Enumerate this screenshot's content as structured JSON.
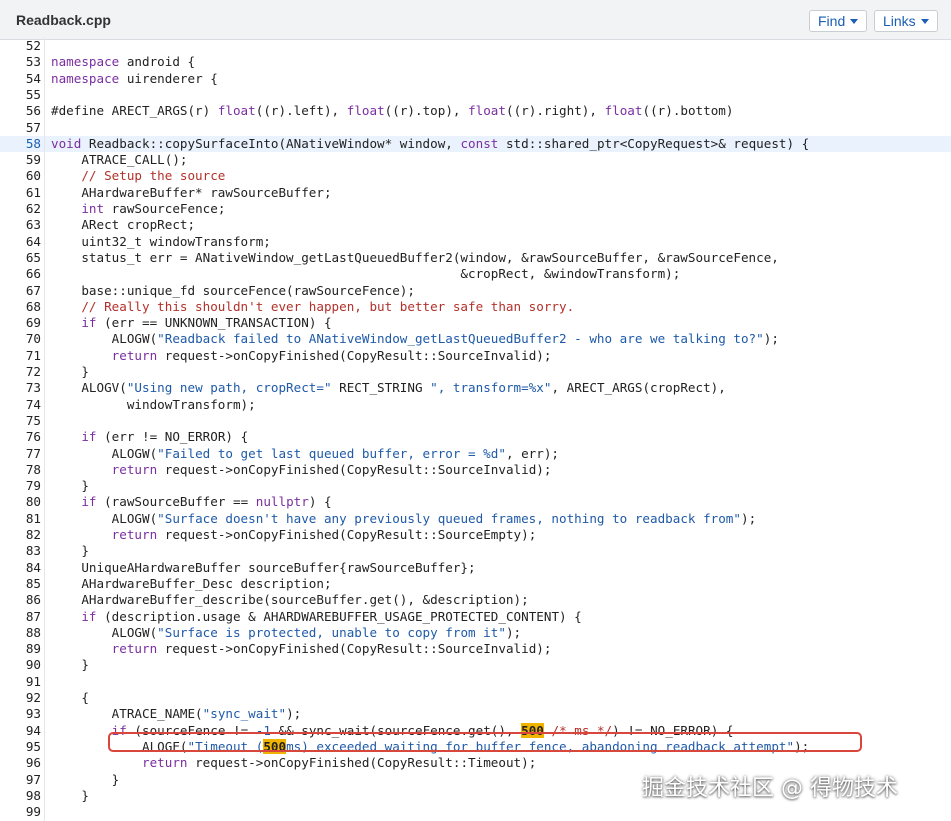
{
  "header": {
    "file_name": "Readback.cpp",
    "find_label": "Find",
    "links_label": "Links"
  },
  "code": {
    "highlighted_line": "58",
    "lines": [
      {
        "n": "52",
        "segs": []
      },
      {
        "n": "53",
        "segs": [
          {
            "t": "namespace",
            "c": "kw"
          },
          {
            "t": " android {",
            "c": ""
          }
        ]
      },
      {
        "n": "54",
        "segs": [
          {
            "t": "namespace",
            "c": "kw"
          },
          {
            "t": " uirenderer {",
            "c": ""
          }
        ]
      },
      {
        "n": "55",
        "segs": []
      },
      {
        "n": "56",
        "segs": [
          {
            "t": "#define ARECT_ARGS(r) ",
            "c": ""
          },
          {
            "t": "float",
            "c": "kw"
          },
          {
            "t": "((r).left), ",
            "c": ""
          },
          {
            "t": "float",
            "c": "kw"
          },
          {
            "t": "((r).top), ",
            "c": ""
          },
          {
            "t": "float",
            "c": "kw"
          },
          {
            "t": "((r).right), ",
            "c": ""
          },
          {
            "t": "float",
            "c": "kw"
          },
          {
            "t": "((r).bottom)",
            "c": ""
          }
        ]
      },
      {
        "n": "57",
        "segs": []
      },
      {
        "n": "58",
        "segs": [
          {
            "t": "void",
            "c": "kw"
          },
          {
            "t": " Readback::copySurfaceInto(ANativeWindow* window, ",
            "c": ""
          },
          {
            "t": "const",
            "c": "kw"
          },
          {
            "t": " std::shared_ptr<CopyRequest>& request) {",
            "c": ""
          }
        ]
      },
      {
        "n": "59",
        "segs": [
          {
            "t": "    ATRACE_CALL();",
            "c": ""
          }
        ]
      },
      {
        "n": "60",
        "segs": [
          {
            "t": "    // Setup the source",
            "c": "cm"
          }
        ]
      },
      {
        "n": "61",
        "segs": [
          {
            "t": "    AHardwareBuffer* rawSourceBuffer;",
            "c": ""
          }
        ]
      },
      {
        "n": "62",
        "segs": [
          {
            "t": "    ",
            "c": ""
          },
          {
            "t": "int",
            "c": "kw"
          },
          {
            "t": " rawSourceFence;",
            "c": ""
          }
        ]
      },
      {
        "n": "63",
        "segs": [
          {
            "t": "    ARect cropRect;",
            "c": ""
          }
        ]
      },
      {
        "n": "64",
        "segs": [
          {
            "t": "    uint32_t windowTransform;",
            "c": ""
          }
        ]
      },
      {
        "n": "65",
        "segs": [
          {
            "t": "    status_t err = ANativeWindow_getLastQueuedBuffer2(window, &rawSourceBuffer, &rawSourceFence,",
            "c": ""
          }
        ]
      },
      {
        "n": "66",
        "segs": [
          {
            "t": "                                                      &cropRect, &windowTransform);",
            "c": ""
          }
        ]
      },
      {
        "n": "67",
        "segs": [
          {
            "t": "    base::unique_fd sourceFence(rawSourceFence);",
            "c": ""
          }
        ]
      },
      {
        "n": "68",
        "segs": [
          {
            "t": "    // Really this shouldn't ever happen, but better safe than sorry.",
            "c": "cm"
          }
        ]
      },
      {
        "n": "69",
        "segs": [
          {
            "t": "    ",
            "c": ""
          },
          {
            "t": "if",
            "c": "kw"
          },
          {
            "t": " (err == UNKNOWN_TRANSACTION) {",
            "c": ""
          }
        ]
      },
      {
        "n": "70",
        "segs": [
          {
            "t": "        ALOGW(",
            "c": ""
          },
          {
            "t": "\"Readback failed to ANativeWindow_getLastQueuedBuffer2 - who are we talking to?\"",
            "c": "str"
          },
          {
            "t": ");",
            "c": ""
          }
        ]
      },
      {
        "n": "71",
        "segs": [
          {
            "t": "        ",
            "c": ""
          },
          {
            "t": "return",
            "c": "kw"
          },
          {
            "t": " request->onCopyFinished(CopyResult::SourceInvalid);",
            "c": ""
          }
        ]
      },
      {
        "n": "72",
        "segs": [
          {
            "t": "    }",
            "c": ""
          }
        ]
      },
      {
        "n": "73",
        "segs": [
          {
            "t": "    ALOGV(",
            "c": ""
          },
          {
            "t": "\"Using new path, cropRect=\"",
            "c": "str"
          },
          {
            "t": " RECT_STRING ",
            "c": ""
          },
          {
            "t": "\", transform=%x\"",
            "c": "str"
          },
          {
            "t": ", ARECT_ARGS(cropRect),",
            "c": ""
          }
        ]
      },
      {
        "n": "74",
        "segs": [
          {
            "t": "          windowTransform);",
            "c": ""
          }
        ]
      },
      {
        "n": "75",
        "segs": []
      },
      {
        "n": "76",
        "segs": [
          {
            "t": "    ",
            "c": ""
          },
          {
            "t": "if",
            "c": "kw"
          },
          {
            "t": " (err != NO_ERROR) {",
            "c": ""
          }
        ]
      },
      {
        "n": "77",
        "segs": [
          {
            "t": "        ALOGW(",
            "c": ""
          },
          {
            "t": "\"Failed to get last queued buffer, error = %d\"",
            "c": "str"
          },
          {
            "t": ", err);",
            "c": ""
          }
        ]
      },
      {
        "n": "78",
        "segs": [
          {
            "t": "        ",
            "c": ""
          },
          {
            "t": "return",
            "c": "kw"
          },
          {
            "t": " request->onCopyFinished(CopyResult::SourceInvalid);",
            "c": ""
          }
        ]
      },
      {
        "n": "79",
        "segs": [
          {
            "t": "    }",
            "c": ""
          }
        ]
      },
      {
        "n": "80",
        "segs": [
          {
            "t": "    ",
            "c": ""
          },
          {
            "t": "if",
            "c": "kw"
          },
          {
            "t": " (rawSourceBuffer == ",
            "c": ""
          },
          {
            "t": "nullptr",
            "c": "kw"
          },
          {
            "t": ") {",
            "c": ""
          }
        ]
      },
      {
        "n": "81",
        "segs": [
          {
            "t": "        ALOGW(",
            "c": ""
          },
          {
            "t": "\"Surface doesn't have any previously queued frames, nothing to readback from\"",
            "c": "str"
          },
          {
            "t": ");",
            "c": ""
          }
        ]
      },
      {
        "n": "82",
        "segs": [
          {
            "t": "        ",
            "c": ""
          },
          {
            "t": "return",
            "c": "kw"
          },
          {
            "t": " request->onCopyFinished(CopyResult::SourceEmpty);",
            "c": ""
          }
        ]
      },
      {
        "n": "83",
        "segs": [
          {
            "t": "    }",
            "c": ""
          }
        ]
      },
      {
        "n": "84",
        "segs": [
          {
            "t": "    UniqueAHardwareBuffer sourceBuffer{rawSourceBuffer};",
            "c": ""
          }
        ]
      },
      {
        "n": "85",
        "segs": [
          {
            "t": "    AHardwareBuffer_Desc description;",
            "c": ""
          }
        ]
      },
      {
        "n": "86",
        "segs": [
          {
            "t": "    AHardwareBuffer_describe(sourceBuffer.get(), &description);",
            "c": ""
          }
        ]
      },
      {
        "n": "87",
        "segs": [
          {
            "t": "    ",
            "c": ""
          },
          {
            "t": "if",
            "c": "kw"
          },
          {
            "t": " (description.usage & AHARDWAREBUFFER_USAGE_PROTECTED_CONTENT) {",
            "c": ""
          }
        ]
      },
      {
        "n": "88",
        "segs": [
          {
            "t": "        ALOGW(",
            "c": ""
          },
          {
            "t": "\"Surface is protected, unable to copy from it\"",
            "c": "str"
          },
          {
            "t": ");",
            "c": ""
          }
        ]
      },
      {
        "n": "89",
        "segs": [
          {
            "t": "        ",
            "c": ""
          },
          {
            "t": "return",
            "c": "kw"
          },
          {
            "t": " request->onCopyFinished(CopyResult::SourceInvalid);",
            "c": ""
          }
        ]
      },
      {
        "n": "90",
        "segs": [
          {
            "t": "    }",
            "c": ""
          }
        ]
      },
      {
        "n": "91",
        "segs": []
      },
      {
        "n": "92",
        "segs": [
          {
            "t": "    {",
            "c": ""
          }
        ]
      },
      {
        "n": "93",
        "segs": [
          {
            "t": "        ATRACE_NAME(",
            "c": ""
          },
          {
            "t": "\"sync_wait\"",
            "c": "str"
          },
          {
            "t": ");",
            "c": ""
          }
        ]
      },
      {
        "n": "94",
        "segs": [
          {
            "t": "        ",
            "c": ""
          },
          {
            "t": "if",
            "c": "kw"
          },
          {
            "t": " (sourceFence != ",
            "c": ""
          },
          {
            "t": "-1",
            "c": "str"
          },
          {
            "t": " && sync_wait(sourceFence.get(), ",
            "c": ""
          },
          {
            "t": "500",
            "c": "mark"
          },
          {
            "t": " ",
            "c": ""
          },
          {
            "t": "/* ms */",
            "c": "cm"
          },
          {
            "t": ") != NO_ERROR) {",
            "c": ""
          }
        ]
      },
      {
        "n": "95",
        "segs": [
          {
            "t": "            ALOGE(",
            "c": ""
          },
          {
            "t": "\"Timeout (",
            "c": "str"
          },
          {
            "t": "500",
            "c": "mark"
          },
          {
            "t": "ms) exceeded waiting for buffer fence, abandoning readback attempt\"",
            "c": "str"
          },
          {
            "t": ");",
            "c": ""
          }
        ]
      },
      {
        "n": "96",
        "segs": [
          {
            "t": "            ",
            "c": ""
          },
          {
            "t": "return",
            "c": "kw"
          },
          {
            "t": " request->onCopyFinished(CopyResult::Timeout);",
            "c": ""
          }
        ]
      },
      {
        "n": "97",
        "segs": [
          {
            "t": "        }",
            "c": ""
          }
        ]
      },
      {
        "n": "98",
        "segs": [
          {
            "t": "    }",
            "c": ""
          }
        ]
      },
      {
        "n": "99",
        "segs": []
      }
    ]
  },
  "watermark": {
    "text": "掘金技术社区 @ 得物技术"
  }
}
